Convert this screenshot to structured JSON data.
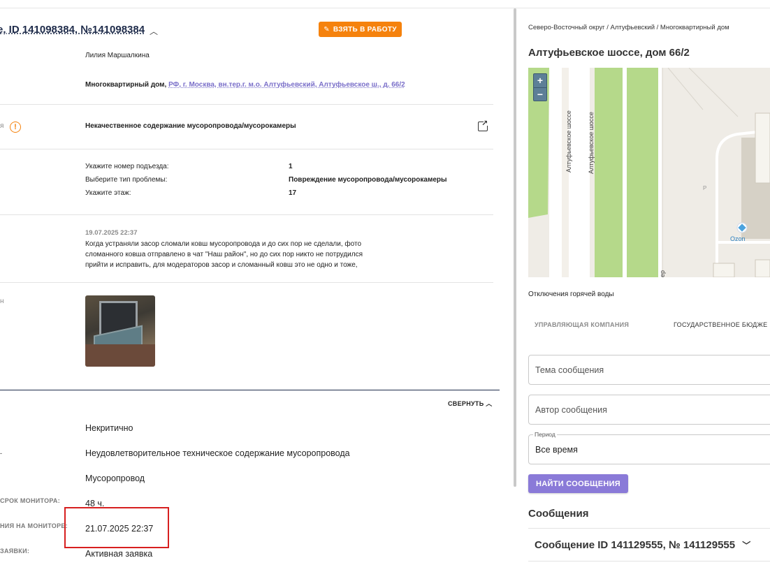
{
  "header": {
    "title": "e, ID 141098384, №141098384",
    "take_button": "ВЗЯТЬ В РАБОТУ"
  },
  "request": {
    "author": "Лилия Маршалкина",
    "object_prefix": "Многоквартирный дом,",
    "object_address": "РФ, г. Москва, вн.тер.г. м.о. Алтуфьевский, Алтуфьевское ш., д. 66/2",
    "category_label_fragment": "я",
    "category": "Некачественное содержание мусоропровода/мусорокамеры",
    "params": [
      {
        "label": "Укажите номер подъезда:",
        "value": "1"
      },
      {
        "label": "Выберите тип проблемы:",
        "value": "Повреждение мусоропровода/мусорокамеры"
      },
      {
        "label": "Укажите этаж:",
        "value": "17"
      }
    ],
    "comment_date": "19.07.2025 22:37",
    "comment_lines": [
      "Когда устраняли засор сломали ковш мусоропровода и до сих пор не сделали, фото",
      "сломанного ковша отправлено в чат \"Наш район\", но до сих пор никто не потрудился",
      "прийти и исправить, для модераторов засор и сломанный ковш это не одно и тоже,"
    ],
    "photo_label_fragment": "н"
  },
  "details": {
    "collapse_label": "СВЕРНУТЬ",
    "rows": [
      {
        "label": "",
        "value": "Некритично"
      },
      {
        "label": "-",
        "value": "Неудовлетворительное техническое содержание мусоропровода"
      },
      {
        "label": "",
        "value": "Мусоропровод"
      },
      {
        "label": "СРОК МОНИТОРА:",
        "value": "48 ч."
      },
      {
        "label": "НИЯ НА МОНИТОРЕ:",
        "value": "21.07.2025 22:37"
      },
      {
        "label": "ЗАЯВКИ:",
        "value": "Активная заявка"
      }
    ]
  },
  "side": {
    "breadcrumbs": "Северо-Восточный округ / Алтуфьевский / Многоквартирный дом",
    "address": "Алтуфьевское шоссе, дом 66/2",
    "map": {
      "zoom_in": "+",
      "zoom_out": "−",
      "street_label_1": "Алтуфьевское шоссе",
      "street_label_2": "Алтуфьевское шоссе",
      "poi": "Ozon",
      "parking": "P",
      "fragment": "ер"
    },
    "hot_water": "Отключения горячей воды",
    "tabs": [
      "УПРАВЛЯЮЩАЯ КОМПАНИЯ",
      "ГОСУДАРСТВЕННОЕ БЮДЖЕ"
    ],
    "topic_placeholder": "Тема сообщения",
    "author_placeholder": "Автор сообщения",
    "period_label": "Период",
    "period_value": "Все время",
    "find_button": "НАЙТИ СООБЩЕНИЯ",
    "messages_title": "Сообщения",
    "message_item": "Сообщение ID 141129555, № 141129555"
  },
  "colors": {
    "accent_orange": "#f5820d",
    "link_purple": "#7a6fc9",
    "button_purple": "#8a7ad8",
    "highlight_red": "#d71f1f",
    "map_green": "#b5d98a"
  }
}
